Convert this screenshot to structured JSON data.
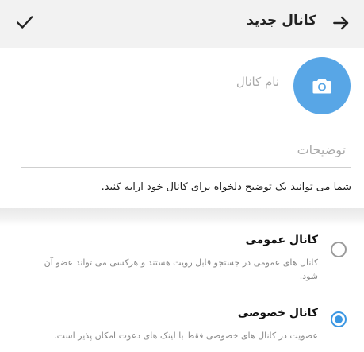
{
  "header": {
    "title": "کانال جدید",
    "confirm_icon": "check-icon",
    "back_icon": "arrow-right-icon"
  },
  "photo": {
    "icon": "camera-icon",
    "accent": "#58a6e6"
  },
  "name_field": {
    "placeholder": "نام کانال",
    "value": ""
  },
  "description_field": {
    "placeholder": "توضیحات",
    "value": "",
    "hint": "شما می توانید یک توضیح دلخواه برای کانال خود ارایه کنید."
  },
  "channel_type": {
    "selected": "private",
    "options": [
      {
        "id": "public",
        "title": "کانال عمومی",
        "description": "کانال های عمومی در جستجو قابل رویت هستند و هرکسی می تواند عضو آن شود.",
        "checked": false
      },
      {
        "id": "private",
        "title": "کانال خصوصی",
        "description": "عضویت در کانال های خصوصی فقط با لینک های دعوت امکان پذیر است.",
        "checked": true
      }
    ]
  },
  "colors": {
    "radio_active": "#3b97e3",
    "appbar_bg": "#f2f2f2"
  }
}
